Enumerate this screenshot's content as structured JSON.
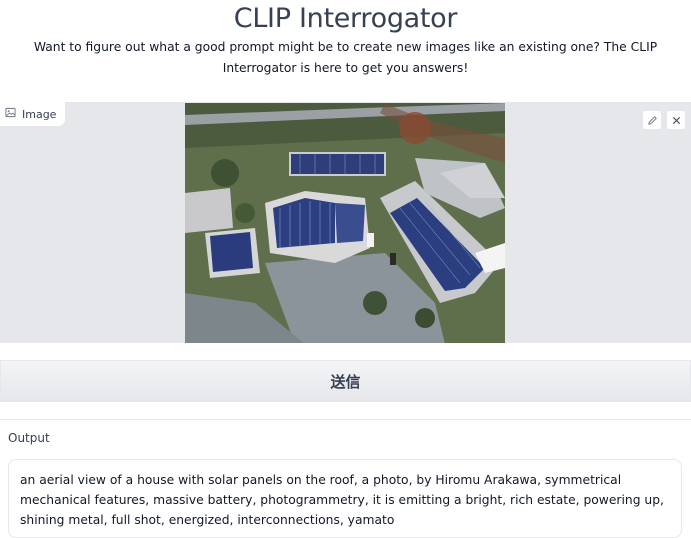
{
  "header": {
    "title": "CLIP Interrogator",
    "description": "Want to figure out what a good prompt might be to create new images like an existing one? The CLIP Interrogator is here to get you answers!"
  },
  "image_input": {
    "label": "Image",
    "label_icon": "image-icon",
    "edit_icon": "pencil-icon",
    "clear_icon": "close-icon"
  },
  "submit": {
    "label": "送信"
  },
  "output": {
    "label": "Output",
    "value": "an aerial view of a house with solar panels on the roof, a photo, by Hiromu Arakawa, symmetrical mechanical features, massive battery, photogrammetry, it is emitting a bright, rich estate, powering up, shining metal, full shot, energized, interconnections, yamato"
  },
  "colors": {
    "panel_bg": "#e5e7eb",
    "button_bg": "#f3f4f6",
    "text": "#374151"
  }
}
